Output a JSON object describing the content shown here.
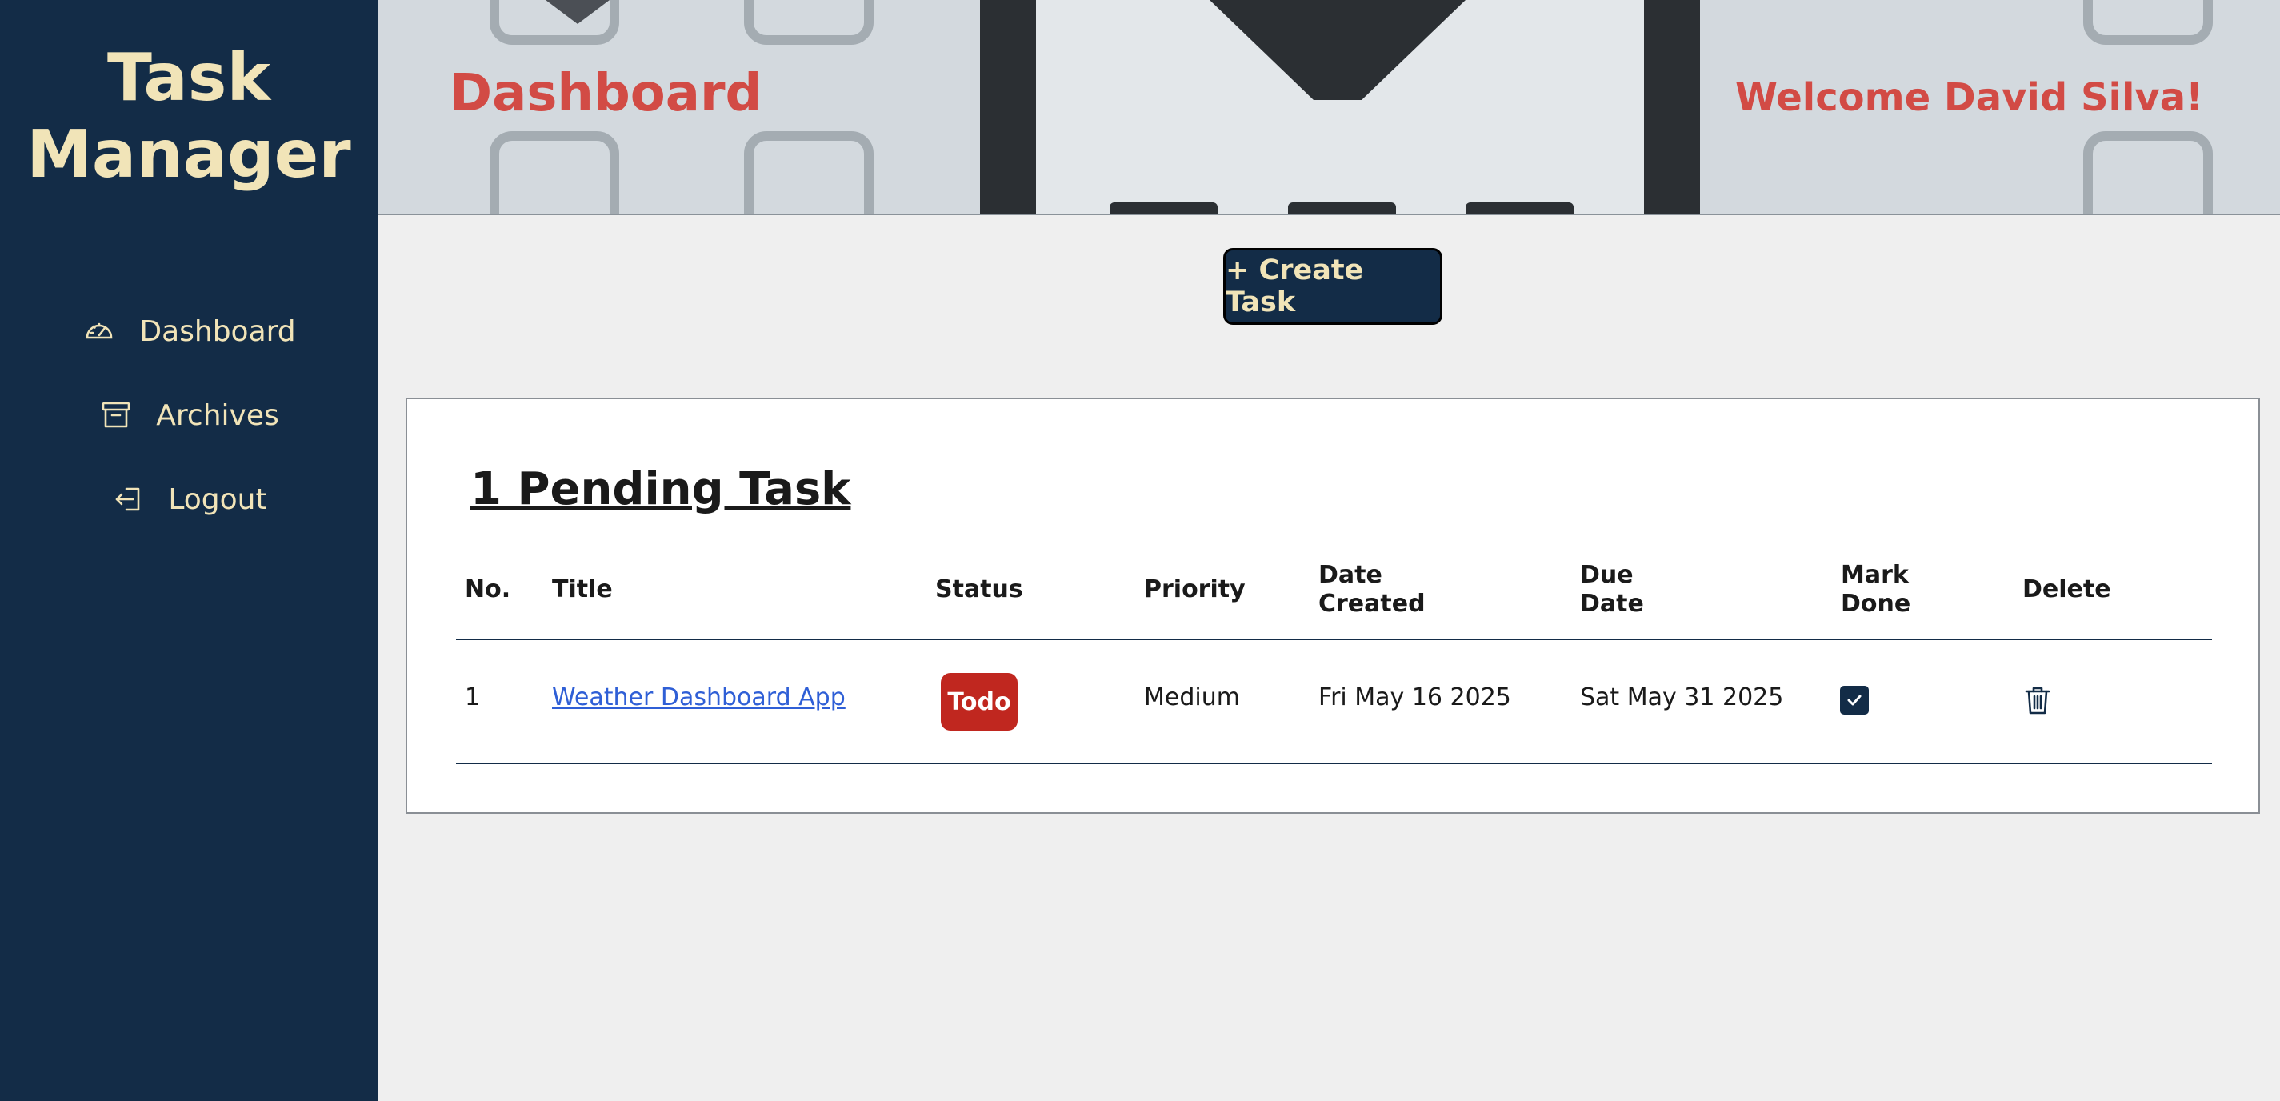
{
  "app": {
    "title_line1": "Task",
    "title_line2": "Manager"
  },
  "sidebar": {
    "items": [
      {
        "label": "Dashboard",
        "icon": "gauge-icon"
      },
      {
        "label": "Archives",
        "icon": "archive-icon"
      },
      {
        "label": "Logout",
        "icon": "logout-icon"
      }
    ]
  },
  "header": {
    "title": "Dashboard",
    "welcome": "Welcome David Silva!"
  },
  "actions": {
    "create_label": "+ Create Task"
  },
  "tasks": {
    "heading": "1 Pending Task",
    "columns": {
      "no": "No.",
      "title": "Title",
      "status": "Status",
      "priority": "Priority",
      "date_created_1": "Date",
      "date_created_2": "Created",
      "due_date_1": "Due",
      "due_date_2": "Date",
      "mark_done_1": "Mark",
      "mark_done_2": "Done",
      "delete": "Delete"
    },
    "rows": [
      {
        "no": "1",
        "title": "Weather Dashboard App",
        "status": "Todo",
        "priority": "Medium",
        "date_created": "Fri May 16 2025",
        "due_date": "Sat May 31 2025",
        "done_icon": "checkbox-icon",
        "delete_icon": "trash-icon"
      }
    ]
  },
  "colors": {
    "sidebar_bg": "#132c47",
    "sidebar_text": "#f1e4b8",
    "accent_red": "#d24b45",
    "status_todo": "#c0271f",
    "link": "#2f5fd6"
  }
}
